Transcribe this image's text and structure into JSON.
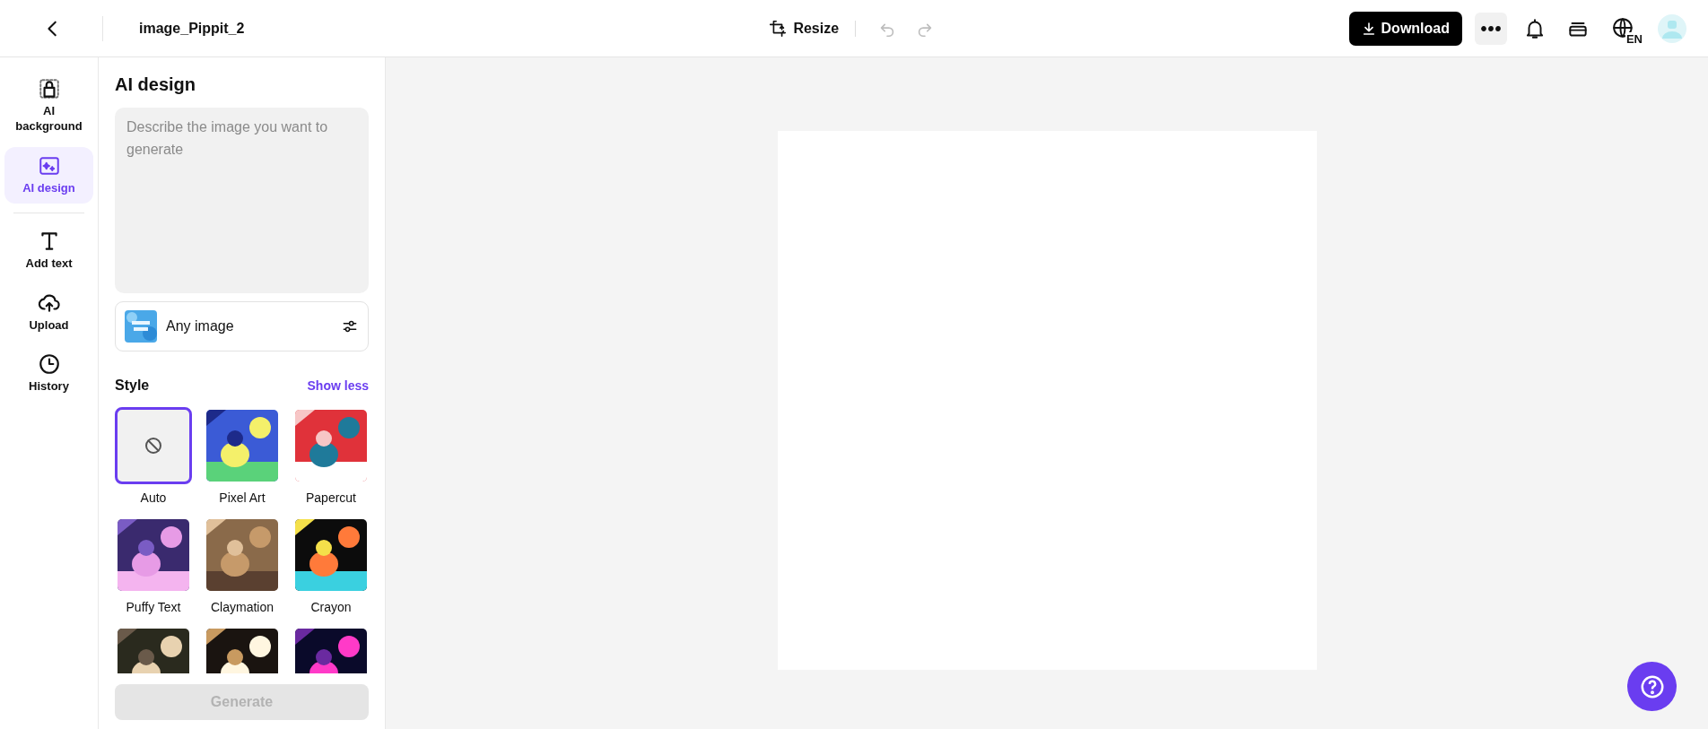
{
  "topbar": {
    "file_name": "image_Pippit_2",
    "resize": "Resize",
    "undo": {
      "disabled": true
    },
    "redo": {
      "disabled": true
    },
    "download": "Download",
    "language": "EN"
  },
  "sidebar": {
    "items": [
      {
        "label": "AI background",
        "kind": "bag",
        "selected": false
      },
      {
        "label": "AI design",
        "kind": "design",
        "selected": true
      },
      {
        "label": "Add text",
        "kind": "text",
        "selected": false
      },
      {
        "label": "Upload",
        "kind": "upload",
        "selected": false
      },
      {
        "label": "History",
        "kind": "history",
        "selected": false
      }
    ]
  },
  "panel": {
    "title": "AI design",
    "prompt": {
      "placeholder": "Describe the image you want to generate"
    },
    "model": {
      "label": "Any image"
    },
    "style_label": "Style",
    "toggle": "Show less",
    "styles": [
      {
        "label": "Auto",
        "kind": "none",
        "selected": true
      },
      {
        "label": "Pixel Art",
        "kind": "picture",
        "selected": false
      },
      {
        "label": "Papercut",
        "kind": "picture",
        "selected": false
      },
      {
        "label": "Puffy Text",
        "kind": "picture",
        "selected": false
      },
      {
        "label": "Claymation",
        "kind": "picture",
        "selected": false
      },
      {
        "label": "Crayon",
        "kind": "picture",
        "selected": false
      },
      {
        "kind": "picture",
        "selected": false
      },
      {
        "kind": "picture",
        "selected": false
      },
      {
        "kind": "picture",
        "selected": false
      }
    ],
    "generate": {
      "label": "Generate",
      "disabled": true
    }
  }
}
